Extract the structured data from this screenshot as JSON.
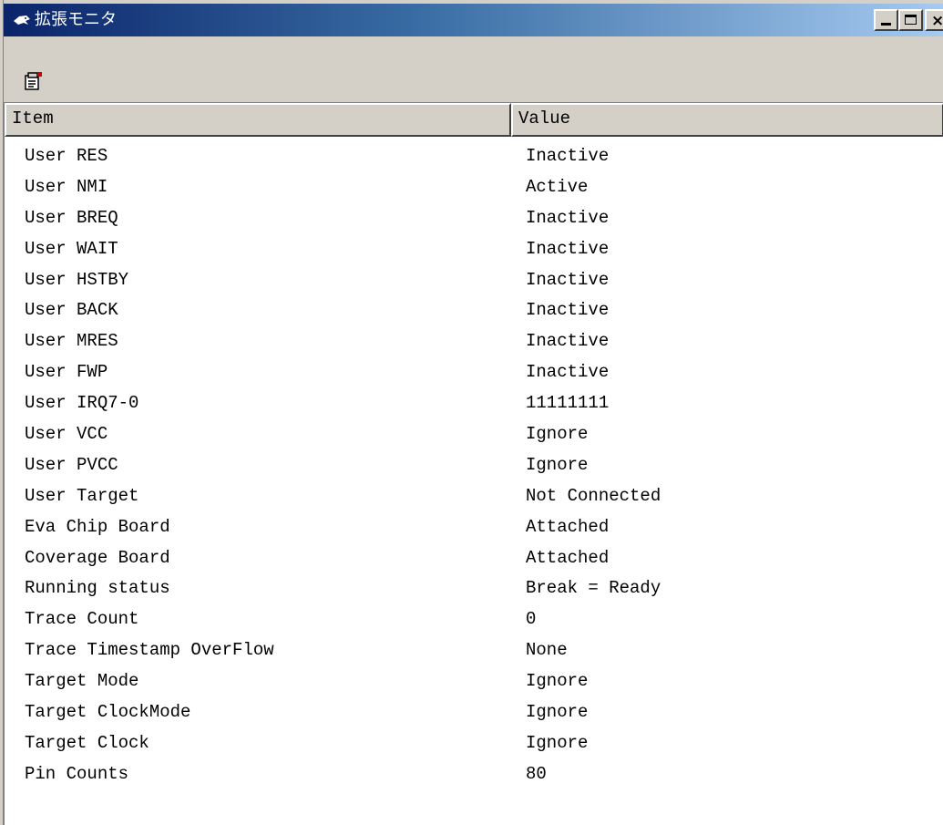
{
  "window": {
    "title": "拡張モニタ",
    "buttons": {
      "minimize": "minimize",
      "maximize": "maximize",
      "close": "×"
    }
  },
  "toolbar": {
    "properties_icon": "properties-icon"
  },
  "list": {
    "columns": [
      "Item",
      "Value"
    ],
    "rows": [
      {
        "item": "User RES",
        "value": "Inactive"
      },
      {
        "item": "User NMI",
        "value": "Active"
      },
      {
        "item": "User BREQ",
        "value": "Inactive"
      },
      {
        "item": "User WAIT",
        "value": "Inactive"
      },
      {
        "item": "User HSTBY",
        "value": "Inactive"
      },
      {
        "item": "User BACK",
        "value": "Inactive"
      },
      {
        "item": "User MRES",
        "value": "Inactive"
      },
      {
        "item": "User FWP",
        "value": "Inactive"
      },
      {
        "item": "User IRQ7-0",
        "value": "11111111"
      },
      {
        "item": "User VCC",
        "value": "Ignore"
      },
      {
        "item": "User PVCC",
        "value": "Ignore"
      },
      {
        "item": "User Target",
        "value": "Not Connected"
      },
      {
        "item": "Eva Chip Board",
        "value": "Attached"
      },
      {
        "item": "Coverage Board",
        "value": "Attached"
      },
      {
        "item": "Running status",
        "value": "Break = Ready"
      },
      {
        "item": "Trace Count",
        "value": "0"
      },
      {
        "item": "Trace Timestamp OverFlow",
        "value": "None"
      },
      {
        "item": "Target Mode",
        "value": "Ignore"
      },
      {
        "item": "Target ClockMode",
        "value": "Ignore"
      },
      {
        "item": "Target Clock",
        "value": "Ignore"
      },
      {
        "item": "Pin Counts",
        "value": "80"
      }
    ]
  },
  "colors": {
    "titlebar_start": "#0a246a",
    "titlebar_end": "#a6caf0",
    "face": "#d4d0c8"
  }
}
